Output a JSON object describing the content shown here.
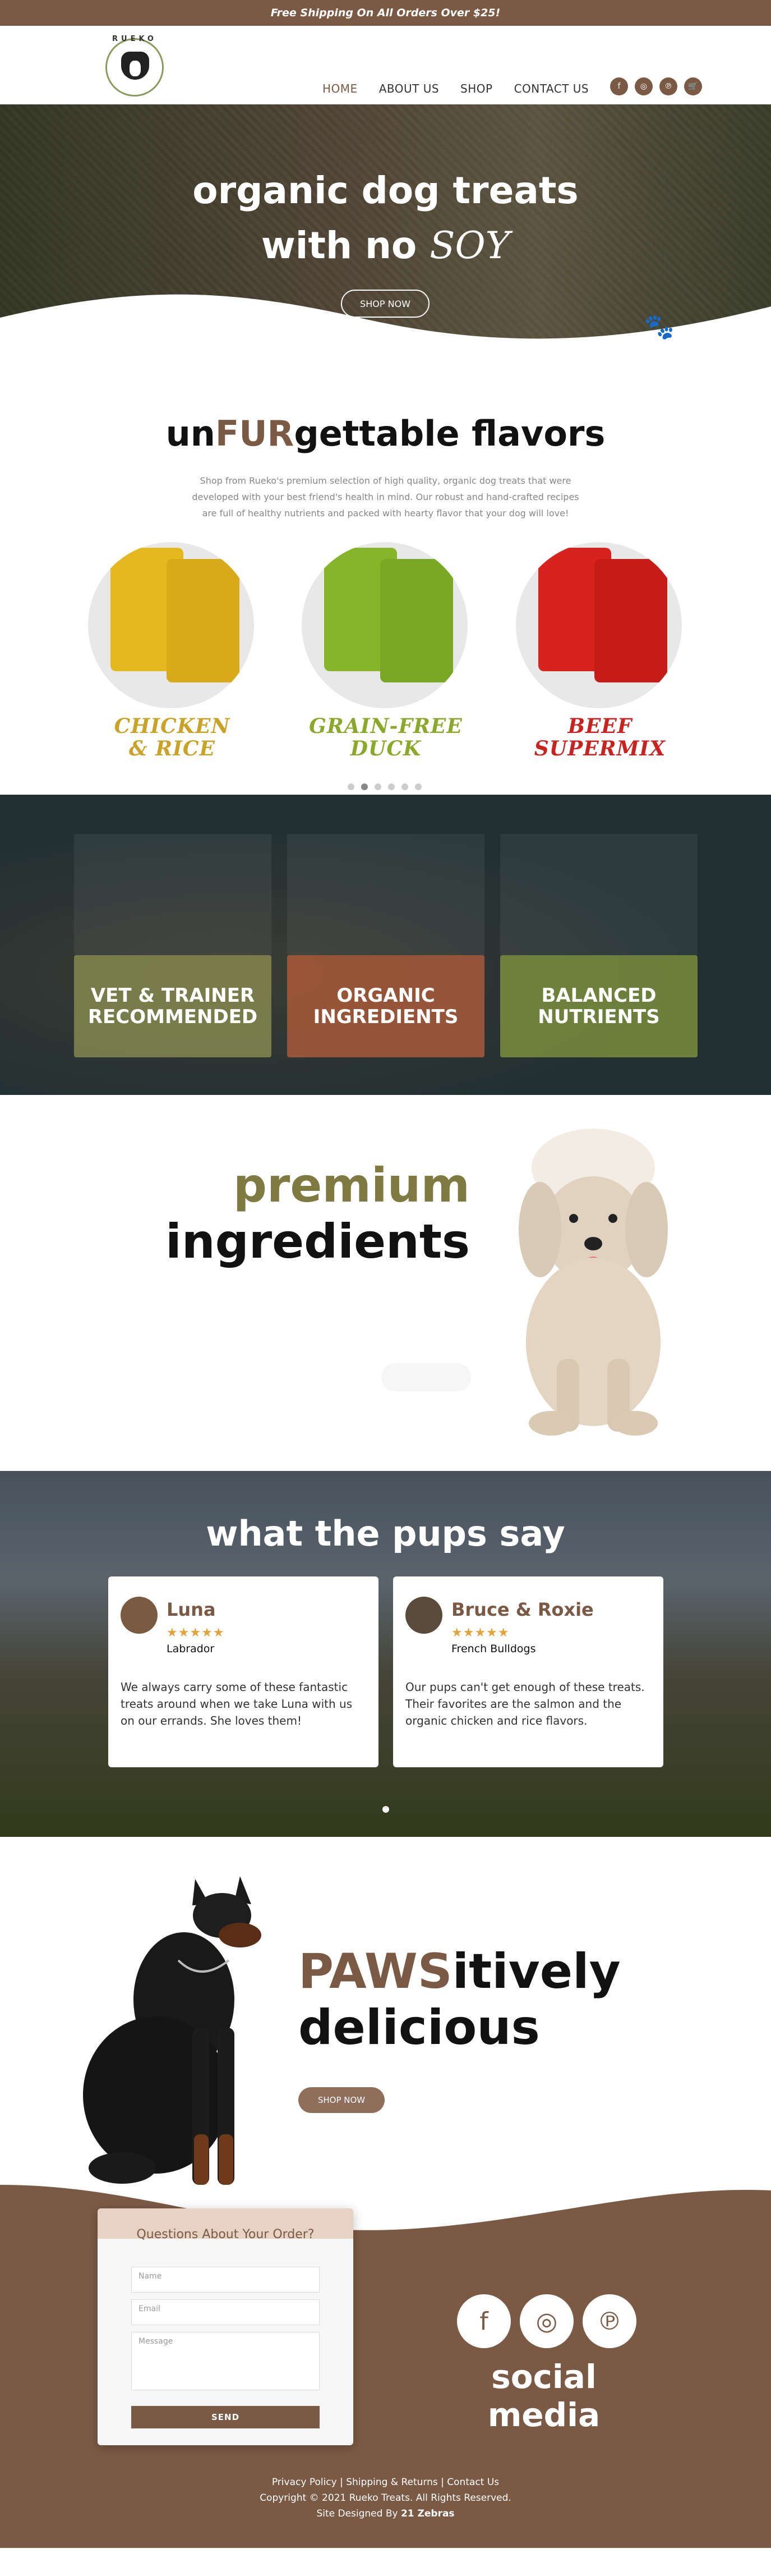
{
  "topbar": {
    "text": "Free Shipping On All Orders Over $25!"
  },
  "brand": {
    "logo_text": "RUEKO"
  },
  "nav": [
    {
      "label": "HOME",
      "active": true
    },
    {
      "label": "ABOUT US",
      "active": false
    },
    {
      "label": "SHOP",
      "active": false
    },
    {
      "label": "CONTACT US",
      "active": false
    }
  ],
  "header_social": [
    "f",
    "◎",
    "℗",
    "🛒"
  ],
  "hero": {
    "title_line1": "organic dog treats",
    "title_line2_prefix": "with no ",
    "title_line2_accent": "SOY",
    "button": "SHOP NOW"
  },
  "flavors": {
    "title_prefix": "un",
    "title_accent": "FUR",
    "title_suffix": "gettable flavors",
    "description": "Shop from Rueko's premium selection of high quality, organic dog treats that were developed with your best friend's health in mind. Our robust and hand-crafted recipes are full of healthy nutrients and packed with hearty flavor that your dog will love!",
    "items": [
      {
        "name_line1": "CHICKEN",
        "name_line2": "& RICE",
        "color": "#c9a227",
        "bag": "#e6b820"
      },
      {
        "name_line1": "GRAIN-FREE",
        "name_line2": "DUCK",
        "color": "#8aa82a",
        "bag": "#86b52a"
      },
      {
        "name_line1": "BEEF",
        "name_line2": "SUPERMIX",
        "color": "#c8231f",
        "bag": "#d8231d"
      }
    ]
  },
  "features": [
    {
      "line1": "VET & TRAINER",
      "line2": "RECOMMENDED"
    },
    {
      "line1": "ORGANIC",
      "line2": "INGREDIENTS"
    },
    {
      "line1": "BALANCED",
      "line2": "NUTRIENTS"
    }
  ],
  "premium": {
    "word1": "premium",
    "word2": "ingredients"
  },
  "reviews": {
    "title": "what the pups say",
    "items": [
      {
        "name": "Luna",
        "stars": "★★★★★",
        "breed": "Labrador",
        "text": "We always carry some of these fantastic treats around when we take Luna with us on our errands. She loves them!"
      },
      {
        "name": "Bruce & Roxie",
        "stars": "★★★★★",
        "breed": "French Bulldogs",
        "text": "Our pups can't get enough of these treats. Their favorites are the salmon and the organic chicken and rice flavors."
      }
    ]
  },
  "paws": {
    "title_accent": "PAWS",
    "title_rest": "itively",
    "title_line2": "delicious",
    "button": "SHOP NOW"
  },
  "contact_form": {
    "title": "Questions About Your Order?",
    "name_placeholder": "Name",
    "email_placeholder": "Email",
    "message_placeholder": "Message",
    "send": "SEND"
  },
  "footer": {
    "social_word": "social media",
    "links": "Privacy Policy | Shipping & Returns | Contact Us",
    "copyright": "Copyright © 2021 Rueko Treats. All Rights Reserved.",
    "designed_prefix": "Site Designed By ",
    "designed_by": "21 Zebras"
  }
}
